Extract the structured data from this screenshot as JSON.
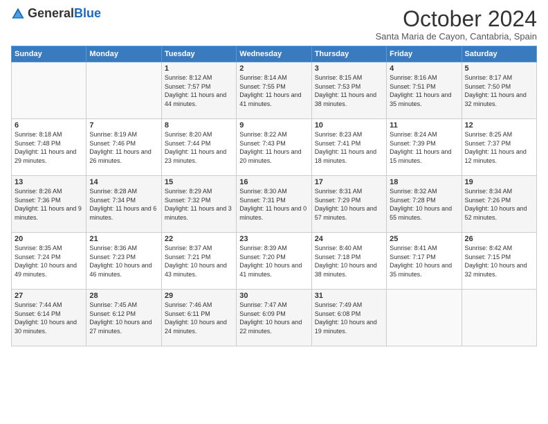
{
  "header": {
    "logo_general": "General",
    "logo_blue": "Blue",
    "month_title": "October 2024",
    "subtitle": "Santa Maria de Cayon, Cantabria, Spain"
  },
  "days_of_week": [
    "Sunday",
    "Monday",
    "Tuesday",
    "Wednesday",
    "Thursday",
    "Friday",
    "Saturday"
  ],
  "weeks": [
    [
      {
        "day": "",
        "sunrise": "",
        "sunset": "",
        "daylight": ""
      },
      {
        "day": "",
        "sunrise": "",
        "sunset": "",
        "daylight": ""
      },
      {
        "day": "1",
        "sunrise": "Sunrise: 8:12 AM",
        "sunset": "Sunset: 7:57 PM",
        "daylight": "Daylight: 11 hours and 44 minutes."
      },
      {
        "day": "2",
        "sunrise": "Sunrise: 8:14 AM",
        "sunset": "Sunset: 7:55 PM",
        "daylight": "Daylight: 11 hours and 41 minutes."
      },
      {
        "day": "3",
        "sunrise": "Sunrise: 8:15 AM",
        "sunset": "Sunset: 7:53 PM",
        "daylight": "Daylight: 11 hours and 38 minutes."
      },
      {
        "day": "4",
        "sunrise": "Sunrise: 8:16 AM",
        "sunset": "Sunset: 7:51 PM",
        "daylight": "Daylight: 11 hours and 35 minutes."
      },
      {
        "day": "5",
        "sunrise": "Sunrise: 8:17 AM",
        "sunset": "Sunset: 7:50 PM",
        "daylight": "Daylight: 11 hours and 32 minutes."
      }
    ],
    [
      {
        "day": "6",
        "sunrise": "Sunrise: 8:18 AM",
        "sunset": "Sunset: 7:48 PM",
        "daylight": "Daylight: 11 hours and 29 minutes."
      },
      {
        "day": "7",
        "sunrise": "Sunrise: 8:19 AM",
        "sunset": "Sunset: 7:46 PM",
        "daylight": "Daylight: 11 hours and 26 minutes."
      },
      {
        "day": "8",
        "sunrise": "Sunrise: 8:20 AM",
        "sunset": "Sunset: 7:44 PM",
        "daylight": "Daylight: 11 hours and 23 minutes."
      },
      {
        "day": "9",
        "sunrise": "Sunrise: 8:22 AM",
        "sunset": "Sunset: 7:43 PM",
        "daylight": "Daylight: 11 hours and 20 minutes."
      },
      {
        "day": "10",
        "sunrise": "Sunrise: 8:23 AM",
        "sunset": "Sunset: 7:41 PM",
        "daylight": "Daylight: 11 hours and 18 minutes."
      },
      {
        "day": "11",
        "sunrise": "Sunrise: 8:24 AM",
        "sunset": "Sunset: 7:39 PM",
        "daylight": "Daylight: 11 hours and 15 minutes."
      },
      {
        "day": "12",
        "sunrise": "Sunrise: 8:25 AM",
        "sunset": "Sunset: 7:37 PM",
        "daylight": "Daylight: 11 hours and 12 minutes."
      }
    ],
    [
      {
        "day": "13",
        "sunrise": "Sunrise: 8:26 AM",
        "sunset": "Sunset: 7:36 PM",
        "daylight": "Daylight: 11 hours and 9 minutes."
      },
      {
        "day": "14",
        "sunrise": "Sunrise: 8:28 AM",
        "sunset": "Sunset: 7:34 PM",
        "daylight": "Daylight: 11 hours and 6 minutes."
      },
      {
        "day": "15",
        "sunrise": "Sunrise: 8:29 AM",
        "sunset": "Sunset: 7:32 PM",
        "daylight": "Daylight: 11 hours and 3 minutes."
      },
      {
        "day": "16",
        "sunrise": "Sunrise: 8:30 AM",
        "sunset": "Sunset: 7:31 PM",
        "daylight": "Daylight: 11 hours and 0 minutes."
      },
      {
        "day": "17",
        "sunrise": "Sunrise: 8:31 AM",
        "sunset": "Sunset: 7:29 PM",
        "daylight": "Daylight: 10 hours and 57 minutes."
      },
      {
        "day": "18",
        "sunrise": "Sunrise: 8:32 AM",
        "sunset": "Sunset: 7:28 PM",
        "daylight": "Daylight: 10 hours and 55 minutes."
      },
      {
        "day": "19",
        "sunrise": "Sunrise: 8:34 AM",
        "sunset": "Sunset: 7:26 PM",
        "daylight": "Daylight: 10 hours and 52 minutes."
      }
    ],
    [
      {
        "day": "20",
        "sunrise": "Sunrise: 8:35 AM",
        "sunset": "Sunset: 7:24 PM",
        "daylight": "Daylight: 10 hours and 49 minutes."
      },
      {
        "day": "21",
        "sunrise": "Sunrise: 8:36 AM",
        "sunset": "Sunset: 7:23 PM",
        "daylight": "Daylight: 10 hours and 46 minutes."
      },
      {
        "day": "22",
        "sunrise": "Sunrise: 8:37 AM",
        "sunset": "Sunset: 7:21 PM",
        "daylight": "Daylight: 10 hours and 43 minutes."
      },
      {
        "day": "23",
        "sunrise": "Sunrise: 8:39 AM",
        "sunset": "Sunset: 7:20 PM",
        "daylight": "Daylight: 10 hours and 41 minutes."
      },
      {
        "day": "24",
        "sunrise": "Sunrise: 8:40 AM",
        "sunset": "Sunset: 7:18 PM",
        "daylight": "Daylight: 10 hours and 38 minutes."
      },
      {
        "day": "25",
        "sunrise": "Sunrise: 8:41 AM",
        "sunset": "Sunset: 7:17 PM",
        "daylight": "Daylight: 10 hours and 35 minutes."
      },
      {
        "day": "26",
        "sunrise": "Sunrise: 8:42 AM",
        "sunset": "Sunset: 7:15 PM",
        "daylight": "Daylight: 10 hours and 32 minutes."
      }
    ],
    [
      {
        "day": "27",
        "sunrise": "Sunrise: 7:44 AM",
        "sunset": "Sunset: 6:14 PM",
        "daylight": "Daylight: 10 hours and 30 minutes."
      },
      {
        "day": "28",
        "sunrise": "Sunrise: 7:45 AM",
        "sunset": "Sunset: 6:12 PM",
        "daylight": "Daylight: 10 hours and 27 minutes."
      },
      {
        "day": "29",
        "sunrise": "Sunrise: 7:46 AM",
        "sunset": "Sunset: 6:11 PM",
        "daylight": "Daylight: 10 hours and 24 minutes."
      },
      {
        "day": "30",
        "sunrise": "Sunrise: 7:47 AM",
        "sunset": "Sunset: 6:09 PM",
        "daylight": "Daylight: 10 hours and 22 minutes."
      },
      {
        "day": "31",
        "sunrise": "Sunrise: 7:49 AM",
        "sunset": "Sunset: 6:08 PM",
        "daylight": "Daylight: 10 hours and 19 minutes."
      },
      {
        "day": "",
        "sunrise": "",
        "sunset": "",
        "daylight": ""
      },
      {
        "day": "",
        "sunrise": "",
        "sunset": "",
        "daylight": ""
      }
    ]
  ]
}
